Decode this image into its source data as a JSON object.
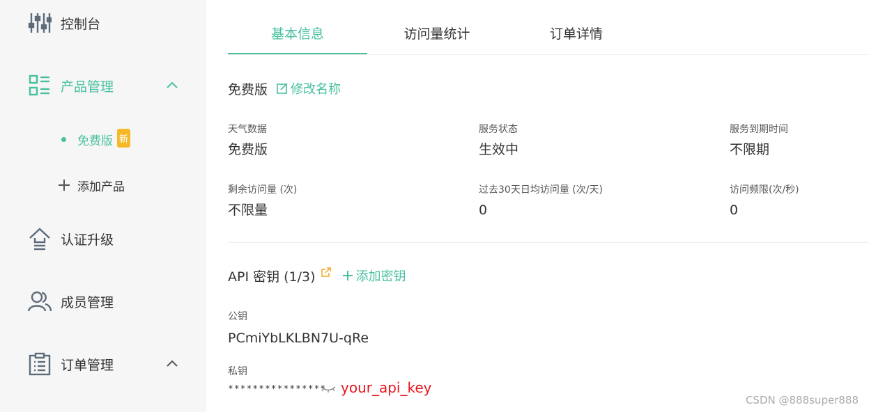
{
  "sidebar": {
    "items": [
      {
        "label": "控制台",
        "icon": "sliders-icon"
      },
      {
        "label": "产品管理",
        "icon": "product-list-icon",
        "expanded": true,
        "active": true
      },
      {
        "label": "认证升级",
        "icon": "upgrade-icon"
      },
      {
        "label": "成员管理",
        "icon": "members-icon"
      },
      {
        "label": "订单管理",
        "icon": "clipboard-icon",
        "expanded": true
      }
    ],
    "sub_items": [
      {
        "label": "免费版",
        "badge": "新",
        "active": true
      },
      {
        "label": "添加产品",
        "icon": "plus-icon"
      }
    ]
  },
  "tabs": [
    {
      "label": "基本信息",
      "active": true
    },
    {
      "label": "访问量统计"
    },
    {
      "label": "订单详情"
    }
  ],
  "plan": {
    "name": "免费版",
    "rename_label": "修改名称"
  },
  "info": {
    "weather_data": {
      "label": "天气数据",
      "value": "免费版"
    },
    "service_status": {
      "label": "服务状态",
      "value": "生效中"
    },
    "service_expiry": {
      "label": "服务到期时间",
      "value": "不限期"
    },
    "remaining_visits": {
      "label": "剩余访问量 (次)",
      "value": "不限量"
    },
    "avg_daily_visits": {
      "label": "过去30天日均访问量 (次/天)",
      "value": "0"
    },
    "rate_limit": {
      "label": "访问频限(次/秒)",
      "value": "0"
    }
  },
  "api_keys": {
    "title": "API 密钥 (1/3)",
    "add_label": "添加密钥",
    "public_key_label": "公钥",
    "public_key_value": "PCmiYbLKLBN7U-qRe",
    "private_key_label": "私钥",
    "private_key_masked": "****************",
    "annotation": "your_api_key"
  },
  "watermark": "CSDN @888super888",
  "colors": {
    "accent": "#48c0a0",
    "badge": "#f5b928",
    "annotation": "#e8141b",
    "external_link": "#f5a623"
  }
}
